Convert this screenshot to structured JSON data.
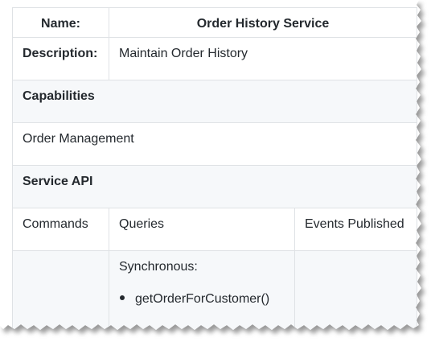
{
  "header": {
    "name_label": "Name:",
    "service_name": "Order History Service"
  },
  "description": {
    "label": "Description:",
    "value": "Maintain Order History"
  },
  "capabilities": {
    "heading": "Capabilities",
    "items": [
      "Order Management"
    ]
  },
  "service_api": {
    "heading": "Service API",
    "columns": {
      "commands": "Commands",
      "queries": "Queries",
      "events": "Events Published"
    },
    "queries": {
      "mode": "Synchronous:",
      "items": [
        "getOrderForCustomer()"
      ]
    }
  }
}
